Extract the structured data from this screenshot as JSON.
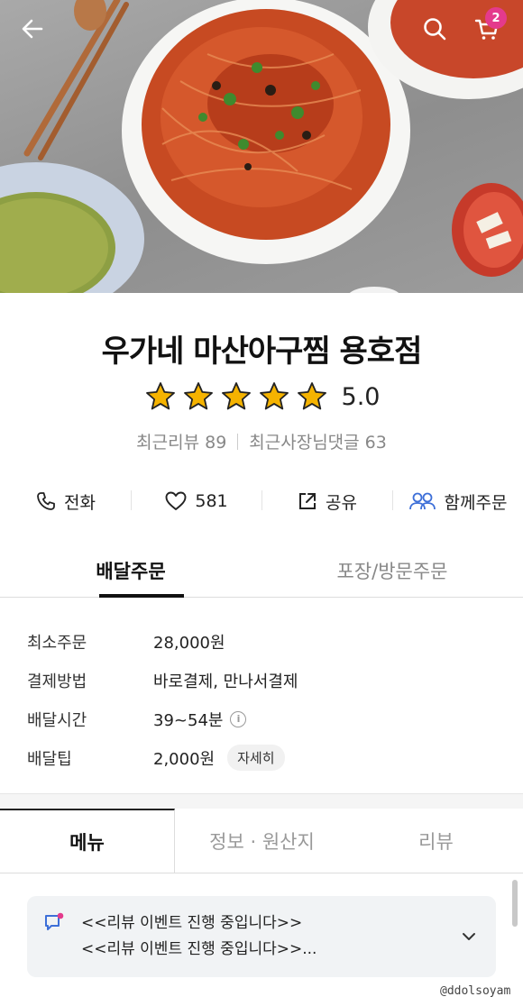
{
  "header": {
    "cart_count": "2",
    "icons": [
      "back-arrow-icon",
      "search-icon",
      "cart-icon"
    ]
  },
  "store": {
    "name": "우가네 마산아구찜 용호점",
    "rating": "5.0",
    "rating_stars": 5,
    "recent_reviews": "최근리뷰 89",
    "owner_replies": "최근사장님댓글 63"
  },
  "actions": [
    {
      "label": "전화",
      "icon": "phone-icon"
    },
    {
      "label": "581",
      "icon": "heart-icon"
    },
    {
      "label": "공유",
      "icon": "share-icon"
    },
    {
      "label": "함께주문",
      "icon": "group-icon"
    }
  ],
  "order_tabs": [
    {
      "label": "배달주문",
      "active": true
    },
    {
      "label": "포장/방문주문",
      "active": false
    }
  ],
  "delivery_info": [
    {
      "label": "최소주문",
      "value": "28,000원"
    },
    {
      "label": "결제방법",
      "value": "바로결제, 만나서결제"
    },
    {
      "label": "배달시간",
      "value": "39~54분"
    },
    {
      "label": "배달팁",
      "value": "2,000원",
      "detail": "자세히"
    }
  ],
  "menu_tabs": [
    {
      "label": "메뉴",
      "active": true
    },
    {
      "label": "정보 · 원산지",
      "active": false
    },
    {
      "label": "리뷰",
      "active": false
    }
  ],
  "notice": {
    "line1": "<<리뷰 이벤트 진행 중입니다>>",
    "line2": "<<리뷰 이벤트 진행 중입니다>>..."
  },
  "watermark": "@ddolsoyam",
  "colors": {
    "badge": "#e43a8c",
    "star": "#f5b300",
    "group_icon": "#3d6fd8"
  }
}
